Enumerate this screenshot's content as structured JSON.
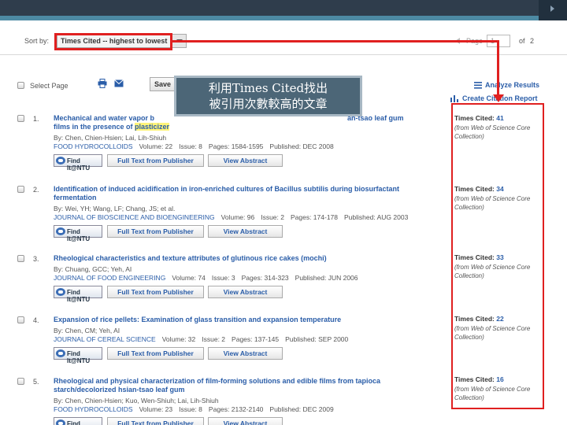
{
  "sort": {
    "label": "Sort by:",
    "value": "Times Cited -- highest to lowest"
  },
  "pager": {
    "page_word": "Page",
    "current": "1",
    "of_word": "of",
    "total": "2"
  },
  "toolbar": {
    "select_page_label": "Select Page",
    "save_label": "Save",
    "analyze_label": "Analyze Results",
    "create_label": "Create Citation Report"
  },
  "callout": {
    "line1": "利用Times Cited找出",
    "line2": "被引用次數較高的文章"
  },
  "common": {
    "times_cited_label": "Times Cited:",
    "collection": "(from Web of Science Core Collection)",
    "find_it": "Find It@NTU",
    "full_text": "Full Text from Publisher",
    "view_abstract": "View Abstract"
  },
  "records": [
    {
      "num": "1.",
      "title_a": "Mechanical and water vapor b",
      "title_b": "an-tsao leaf gum",
      "title_line2_pre": "films in the presence of ",
      "title_line2_hl": "plasticizer",
      "by": "By: Chen, Chien-Hsien; Lai, Lih-Shiuh",
      "journal": "FOOD HYDROCOLLOIDS",
      "volume": "Volume: 22",
      "issue": "Issue: 8",
      "pages": "Pages: 1584-1595",
      "published": "Published: DEC 2008",
      "times_cited": "41"
    },
    {
      "num": "2.",
      "title": "Identification of induced acidification in iron-enriched cultures of Bacillus subtilis during biosurfactant fermentation",
      "by": "By: Wei, YH; Wang, LF; Chang, JS; et al.",
      "journal": "JOURNAL OF BIOSCIENCE AND BIOENGINEERING",
      "volume": "Volume: 96",
      "issue": "Issue: 2",
      "pages": "Pages: 174-178",
      "published": "Published: AUG 2003",
      "times_cited": "34"
    },
    {
      "num": "3.",
      "title": "Rheological characteristics and texture attributes of glutinous rice cakes (mochi)",
      "by": "By: Chuang, GCC; Yeh, AI",
      "journal": "JOURNAL OF FOOD ENGINEERING",
      "volume": "Volume: 74",
      "issue": "Issue: 3",
      "pages": "Pages: 314-323",
      "published": "Published: JUN 2006",
      "times_cited": "33"
    },
    {
      "num": "4.",
      "title": "Expansion of rice pellets: Examination of glass transition and expansion temperature",
      "by": "By: Chen, CM; Yeh, AI",
      "journal": "JOURNAL OF CEREAL SCIENCE",
      "volume": "Volume: 32",
      "issue": "Issue: 2",
      "pages": "Pages: 137-145",
      "published": "Published: SEP 2000",
      "times_cited": "22"
    },
    {
      "num": "5.",
      "title": "Rheological and physical characterization of film-forming solutions and edible films from tapioca starch/decolorized hsian-tsao leaf gum",
      "by": "By: Chen, Chien-Hsien; Kuo, Wen-Shiuh; Lai, Lih-Shiuh",
      "journal": "FOOD HYDROCOLLOIDS",
      "volume": "Volume: 23",
      "issue": "Issue: 8",
      "pages": "Pages: 2132-2140",
      "published": "Published: DEC 2009",
      "times_cited": "16"
    }
  ],
  "colors": {
    "topbar": "#2f3d4c",
    "link_blue": "#2a5da8",
    "highlight_red": "#e02020",
    "callout_bg": "#4c6677"
  }
}
